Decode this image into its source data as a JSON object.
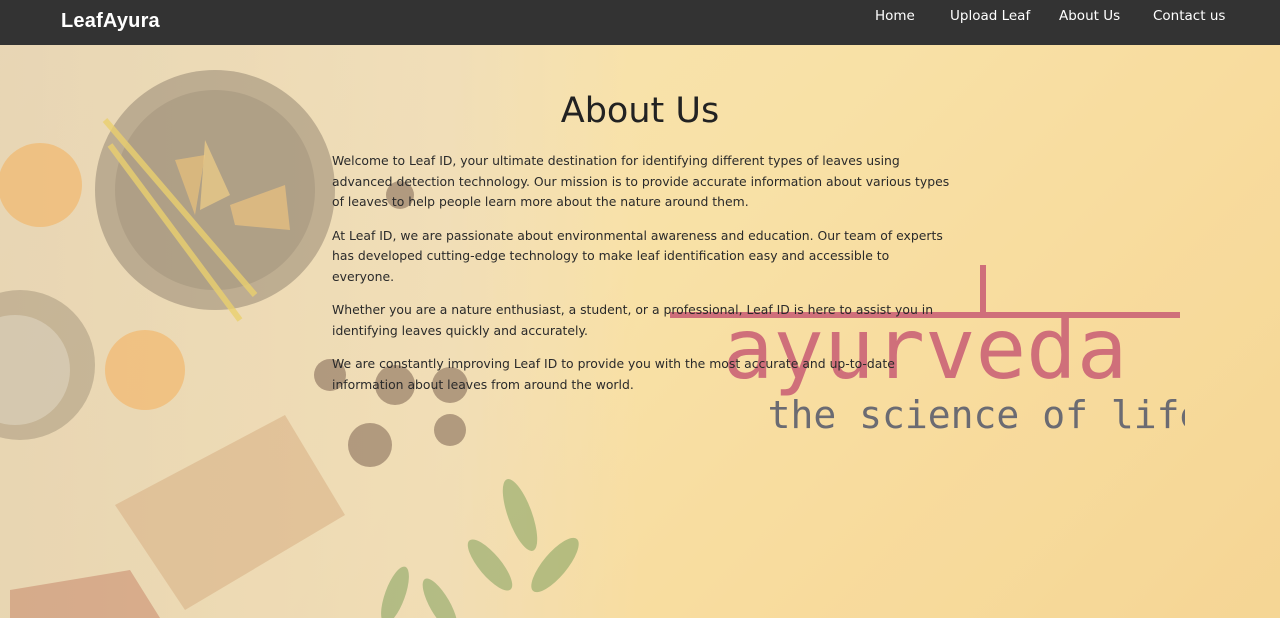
{
  "navbar": {
    "brand": "LeafAyura",
    "links": [
      "Home",
      "Upload Leaf",
      "About Us",
      "Contact us"
    ]
  },
  "page": {
    "title": "About Us",
    "paragraphs": [
      "Welcome to Leaf ID, your ultimate destination for identifying different types of leaves using advanced detection technology. Our mission is to provide accurate information about various types of leaves to help people learn more about the nature around them.",
      "At Leaf ID, we are passionate about environmental awareness and education. Our team of experts has developed cutting-edge technology to make leaf identification easy and accessible to everyone.",
      "Whether you are a nature enthusiast, a student, or a professional, Leaf ID is here to assist you in identifying leaves quickly and accurately.",
      "We are constantly improving Leaf ID to provide you with the most accurate and up-to-date information about leaves from around the world."
    ]
  },
  "background": {
    "logo_word": "ayurveda",
    "logo_tagline": "the science of life"
  },
  "colors": {
    "navbar": "#333333",
    "logo_word": "#cf6f7a",
    "logo_tagline": "#6b6b72"
  }
}
